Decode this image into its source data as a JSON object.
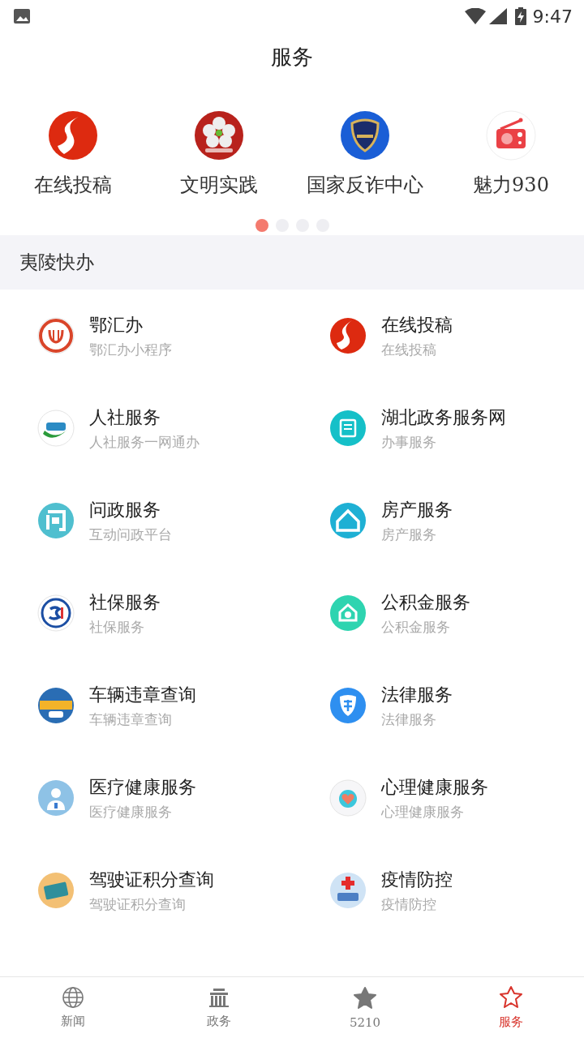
{
  "status_bar": {
    "time": "9:47"
  },
  "title": "服务",
  "carousel": {
    "items": [
      {
        "label": "在线投稿"
      },
      {
        "label": "文明实践"
      },
      {
        "label": "国家反诈中心"
      },
      {
        "label": "魅力930"
      }
    ],
    "dots": [
      {
        "selected": true
      },
      {
        "selected": false
      },
      {
        "selected": false
      },
      {
        "selected": false
      }
    ]
  },
  "section": {
    "title": "夷陵快办"
  },
  "services": [
    {
      "title": "鄂汇办",
      "subtitle": "鄂汇办小程序"
    },
    {
      "title": "在线投稿",
      "subtitle": "在线投稿"
    },
    {
      "title": "人社服务",
      "subtitle": "人社服务一网通办"
    },
    {
      "title": "湖北政务服务网",
      "subtitle": "办事服务"
    },
    {
      "title": "问政服务",
      "subtitle": "互动问政平台"
    },
    {
      "title": "房产服务",
      "subtitle": "房产服务"
    },
    {
      "title": "社保服务",
      "subtitle": "社保服务"
    },
    {
      "title": "公积金服务",
      "subtitle": "公积金服务"
    },
    {
      "title": "车辆违章查询",
      "subtitle": "车辆违章查询"
    },
    {
      "title": "法律服务",
      "subtitle": "法律服务"
    },
    {
      "title": "医疗健康服务",
      "subtitle": "医疗健康服务"
    },
    {
      "title": "心理健康服务",
      "subtitle": "心理健康服务"
    },
    {
      "title": "驾驶证积分查询",
      "subtitle": "驾驶证积分查询"
    },
    {
      "title": "疫情防控",
      "subtitle": "疫情防控"
    }
  ],
  "tabs": [
    {
      "label": "新闻",
      "selected": false
    },
    {
      "label": "政务",
      "selected": false
    },
    {
      "label": "5210",
      "selected": false
    },
    {
      "label": "服务",
      "selected": true
    }
  ]
}
